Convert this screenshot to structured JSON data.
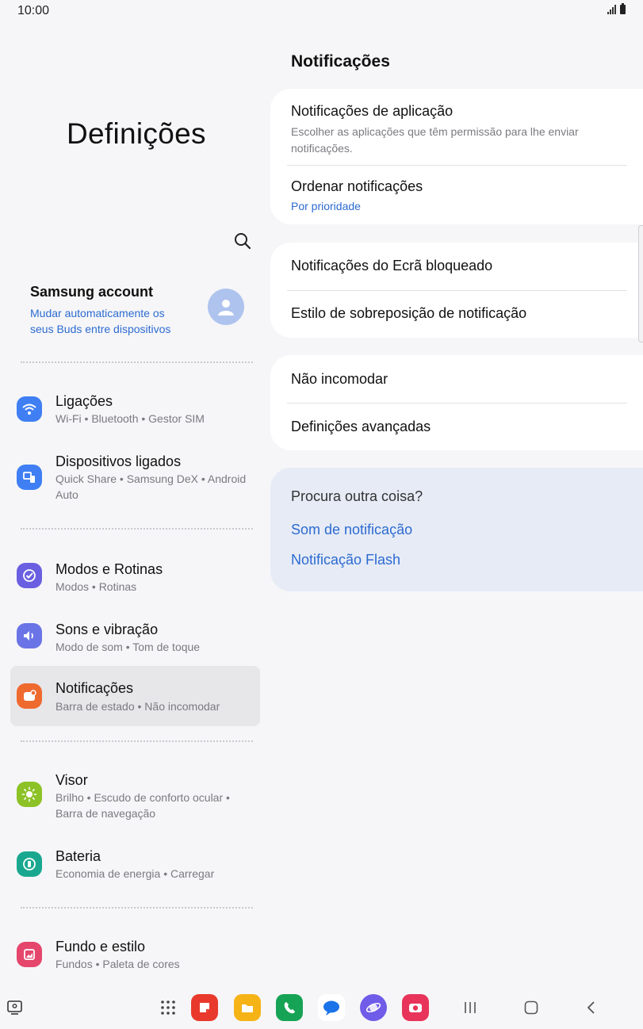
{
  "status_bar": {
    "time": "10:00"
  },
  "left": {
    "heading": "Definições",
    "account": {
      "name": "Samsung account",
      "subtitle": "Mudar automaticamente os seus Buds entre dispositivos"
    },
    "items": [
      {
        "title": "Ligações",
        "subtitle": "Wi-Fi  •  Bluetooth  •  Gestor SIM",
        "icon": "wifi-icon",
        "color": "#3f7ff3"
      },
      {
        "title": "Dispositivos ligados",
        "subtitle": "Quick Share  •  Samsung DeX  •  Android Auto",
        "icon": "connected-devices-icon",
        "color": "#3f7ff3"
      },
      {
        "title": "Modos e Rotinas",
        "subtitle": "Modos  •  Rotinas",
        "icon": "modes-icon",
        "color": "#6a5fe0"
      },
      {
        "title": "Sons e vibração",
        "subtitle": "Modo de som  •  Tom de toque",
        "icon": "sound-icon",
        "color": "#6a74e6"
      },
      {
        "title": "Notificações",
        "subtitle": "Barra de estado  •  Não incomodar",
        "icon": "notifications-icon",
        "color": "#ef6a2f"
      },
      {
        "title": "Visor",
        "subtitle": "Brilho  •  Escudo de conforto ocular  •  Barra de navegação",
        "icon": "brightness-icon",
        "color": "#8cc226"
      },
      {
        "title": "Bateria",
        "subtitle": "Economia de energia  •  Carregar",
        "icon": "battery-icon",
        "color": "#19a88f"
      },
      {
        "title": "Fundo e estilo",
        "subtitle": "Fundos  •  Paleta de cores",
        "icon": "wallpaper-icon",
        "color": "#e5466c"
      }
    ]
  },
  "right": {
    "title": "Notificações",
    "group1": {
      "app_notifications": {
        "title": "Notificações de aplicação",
        "subtitle": "Escolher as aplicações que têm permissão para lhe enviar notificações."
      },
      "sort": {
        "title": "Ordenar notificações",
        "value": "Por prioridade"
      }
    },
    "group2": {
      "lock_screen": "Notificações do Ecrã bloqueado",
      "popup_style": "Estilo de sobreposição de notificação"
    },
    "group3": {
      "dnd": "Não incomodar",
      "advanced": "Definições avançadas"
    },
    "suggestions": {
      "heading": "Procura outra coisa?",
      "links": [
        "Som de notificação",
        "Notificação Flash"
      ]
    }
  },
  "taskbar": {
    "apps": [
      {
        "icon": "samsung-notes-icon",
        "color": "#e8392c"
      },
      {
        "icon": "my-files-icon",
        "color": "#f6b316"
      },
      {
        "icon": "phone-icon",
        "color": "#17a355"
      },
      {
        "icon": "messages-icon",
        "color": "#ffffff"
      },
      {
        "icon": "internet-icon",
        "color": "#6f5ce8"
      },
      {
        "icon": "camera-icon",
        "color": "#e8345a"
      }
    ]
  }
}
